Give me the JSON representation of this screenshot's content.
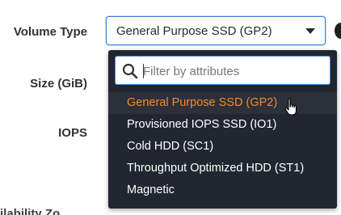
{
  "form": {
    "volume_type_label": "Volume Type",
    "size_label": "Size (GiB)",
    "iops_label": "IOPS",
    "cut_off_label": "ilability Zo"
  },
  "select": {
    "value": "General Purpose SSD (GP2)",
    "icon": "caret-down-icon"
  },
  "dropdown": {
    "filter_placeholder": "Filter by attributes",
    "search_icon": "search-icon",
    "options": [
      {
        "label": "General Purpose SSD (GP2)",
        "selected": true
      },
      {
        "label": "Provisioned IOPS SSD (IO1)",
        "selected": false
      },
      {
        "label": "Cold HDD (SC1)",
        "selected": false
      },
      {
        "label": "Throughput Optimized HDD (ST1)",
        "selected": false
      },
      {
        "label": "Magnetic",
        "selected": false
      }
    ]
  },
  "colors": {
    "accent_border": "#3b7fd8",
    "dropdown_bg": "#222630",
    "selected_text": "#f28a2e",
    "option_text": "#ffffff"
  }
}
